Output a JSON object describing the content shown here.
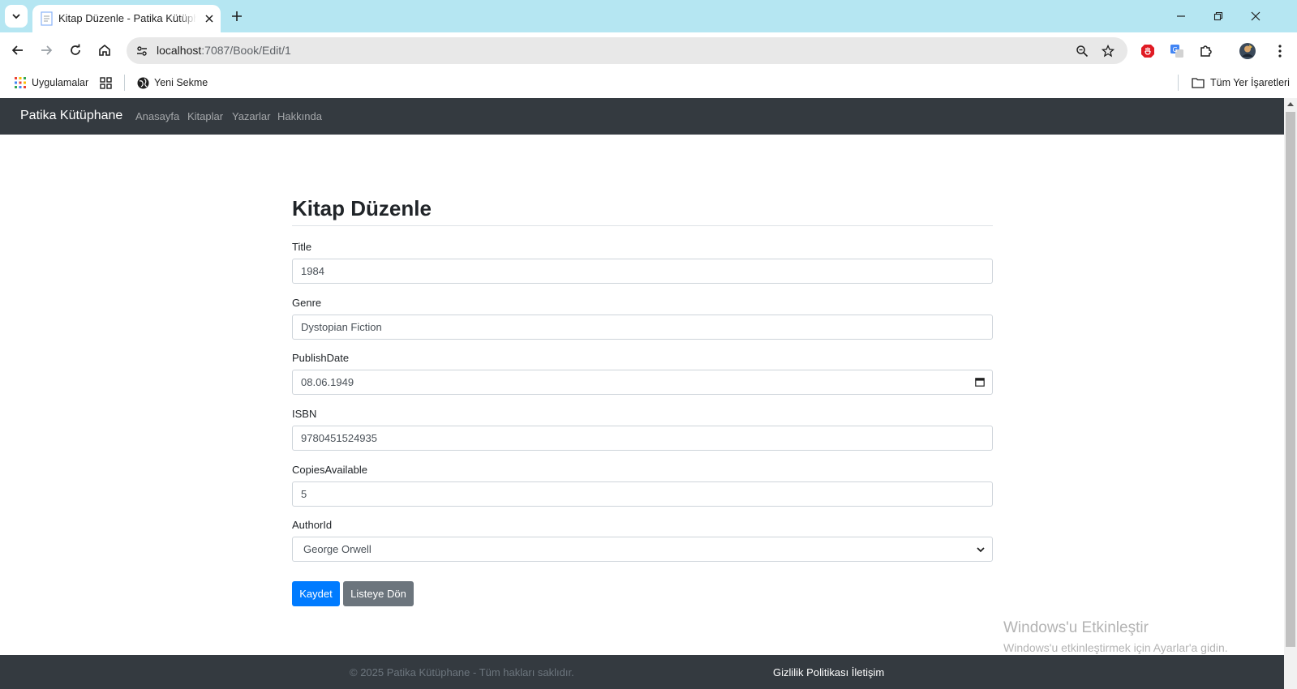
{
  "browser": {
    "tab": {
      "title": "Kitap Düzenle - Patika Kütüphane"
    },
    "address_bar": {
      "host": "localhost",
      "path": ":7087/Book/Edit/1"
    },
    "bookmarks": {
      "apps_label": "Uygulamalar",
      "new_tab_label": "Yeni Sekme",
      "all_bookmarks_label": "Tüm Yer İşaretleri"
    }
  },
  "navbar": {
    "brand": "Patika Kütüphane",
    "links": [
      "Anasayfa",
      "Kitaplar",
      "Yazarlar",
      "Hakkında"
    ]
  },
  "form": {
    "heading": "Kitap Düzenle",
    "fields": [
      {
        "label": "Title",
        "value": "1984"
      },
      {
        "label": "Genre",
        "value": "Dystopian Fiction"
      },
      {
        "label": "PublishDate",
        "value": "08.06.1949"
      },
      {
        "label": "ISBN",
        "value": "9780451524935"
      },
      {
        "label": "CopiesAvailable",
        "value": "5"
      },
      {
        "label": "AuthorId",
        "value": "George Orwell"
      }
    ],
    "save_label": "Kaydet",
    "back_label": "Listeye Dön"
  },
  "watermark": {
    "title": "Windows'u Etkinleştir",
    "subtitle": "Windows'u etkinleştirmek için Ayarlar'a gidin."
  },
  "footer": {
    "copyright": "© 2025 Patika Kütüphane - Tüm hakları saklıdır.",
    "links": "Gizlilik Politikası İletişim"
  },
  "colors": {
    "tabstrip": "#b5e6f2",
    "navbar": "#343a40",
    "primary": "#007bff",
    "secondary": "#6c757d"
  }
}
